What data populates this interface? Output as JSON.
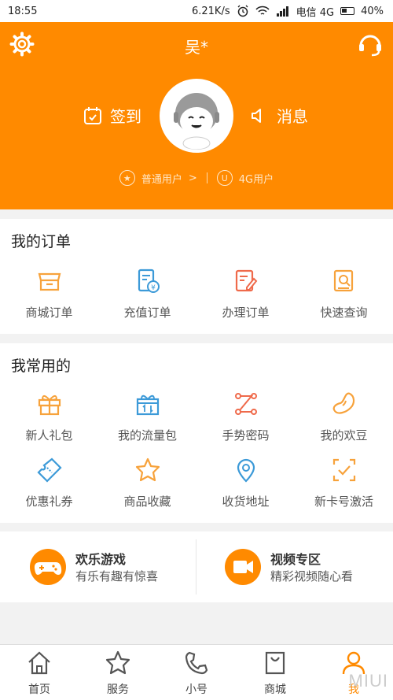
{
  "status_bar": {
    "time": "18:55",
    "speed": "6.21K/s",
    "carrier": "电信 4G",
    "battery": "40%"
  },
  "header": {
    "username": "吴*",
    "checkin_label": "签到",
    "message_label": "消息",
    "user_type": "普通用户",
    "user_type_arrow": ">",
    "network_type": "4G用户",
    "network_badge": "U",
    "bg_color": "#ff8a00"
  },
  "orders": {
    "title": "我的订单",
    "items": [
      {
        "label": "商城订单",
        "icon": "store-icon"
      },
      {
        "label": "充值订单",
        "icon": "recharge-order-icon"
      },
      {
        "label": "办理订单",
        "icon": "handle-order-icon"
      },
      {
        "label": "快速查询",
        "icon": "quick-query-icon"
      }
    ]
  },
  "common": {
    "title": "我常用的",
    "items": [
      {
        "label": "新人礼包",
        "icon": "gift-icon"
      },
      {
        "label": "我的流量包",
        "icon": "data-pack-icon"
      },
      {
        "label": "手势密码",
        "icon": "gesture-password-icon"
      },
      {
        "label": "我的欢豆",
        "icon": "bean-icon"
      },
      {
        "label": "优惠礼券",
        "icon": "coupon-icon"
      },
      {
        "label": "商品收藏",
        "icon": "star-icon"
      },
      {
        "label": "收货地址",
        "icon": "location-icon"
      },
      {
        "label": "新卡号激活",
        "icon": "activate-icon"
      }
    ]
  },
  "promo": {
    "game": {
      "title": "欢乐游戏",
      "subtitle": "有乐有趣有惊喜",
      "icon": "gamepad-icon"
    },
    "video": {
      "title": "视频专区",
      "subtitle": "精彩视频随心看",
      "icon": "video-icon"
    }
  },
  "tabbar": {
    "items": [
      {
        "label": "首页",
        "icon": "home-icon"
      },
      {
        "label": "服务",
        "icon": "star-icon"
      },
      {
        "label": "小号",
        "icon": "phone-icon"
      },
      {
        "label": "商城",
        "icon": "shop-icon"
      },
      {
        "label": "我",
        "icon": "user-icon",
        "active": true
      }
    ],
    "active_color": "#ff8a00"
  }
}
